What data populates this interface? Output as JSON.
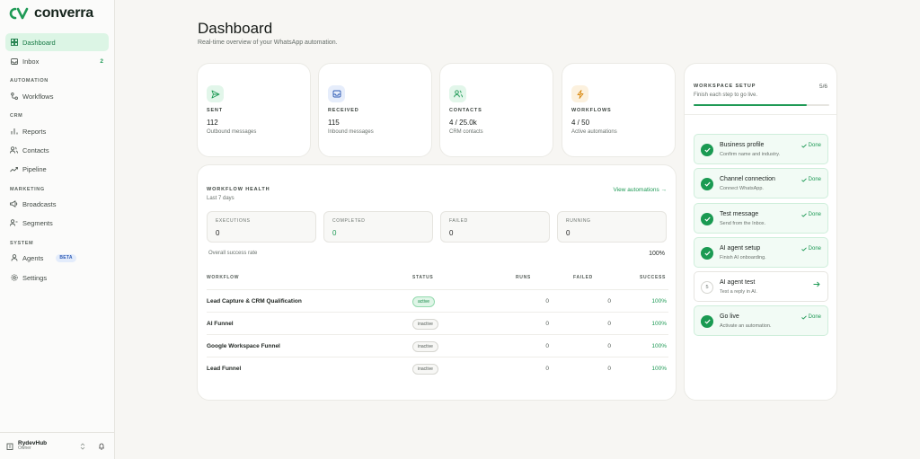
{
  "brand": {
    "name": "converra",
    "logo_text": "CV"
  },
  "sidebar": {
    "top_items": [
      {
        "label": "Dashboard",
        "icon": "grid-icon",
        "active": true
      },
      {
        "label": "Inbox",
        "icon": "inbox-icon",
        "badge": "2"
      }
    ],
    "sections": [
      {
        "label": "AUTOMATION",
        "items": [
          {
            "label": "Workflows",
            "icon": "workflow-icon"
          }
        ]
      },
      {
        "label": "CRM",
        "items": [
          {
            "label": "Reports",
            "icon": "bar-chart-icon"
          },
          {
            "label": "Contacts",
            "icon": "users-icon"
          },
          {
            "label": "Pipeline",
            "icon": "trend-icon"
          }
        ]
      },
      {
        "label": "MARKETING",
        "items": [
          {
            "label": "Broadcasts",
            "icon": "broadcast-icon"
          },
          {
            "label": "Segments",
            "icon": "segments-icon"
          }
        ]
      },
      {
        "label": "SYSTEM",
        "items": [
          {
            "label": "Agents",
            "icon": "agent-icon",
            "tag": "BETA"
          },
          {
            "label": "Settings",
            "icon": "gear-icon"
          }
        ]
      }
    ],
    "user": {
      "name": "RydevHub",
      "role": "Owner"
    }
  },
  "header": {
    "title": "Dashboard",
    "subtitle": "Real-time overview of your WhatsApp automation."
  },
  "stats": [
    {
      "label": "SENT",
      "value": "112",
      "desc": "Outbound messages",
      "icon": "send-icon",
      "color": "#1f9a56",
      "bg": "#e2f6ea"
    },
    {
      "label": "RECEIVED",
      "value": "115",
      "desc": "Inbound messages",
      "icon": "inbox-icon",
      "color": "#2f5bb4",
      "bg": "#e6edfb"
    },
    {
      "label": "CONTACTS",
      "value": "4 / 25.0k",
      "desc": "CRM contacts",
      "icon": "users-icon",
      "color": "#1f9a56",
      "bg": "#e2f6ea"
    },
    {
      "label": "WORKFLOWS",
      "value": "4 / 50",
      "desc": "Active automations",
      "icon": "bolt-icon",
      "color": "#d98a12",
      "bg": "#fcf1de"
    }
  ],
  "workflow_health": {
    "title": "WORKFLOW HEALTH",
    "subtitle": "Last 7 days",
    "link": "View automations →",
    "metrics": [
      {
        "label": "EXECUTIONS",
        "value": "0"
      },
      {
        "label": "COMPLETED",
        "value": "0"
      },
      {
        "label": "FAILED",
        "value": "0"
      },
      {
        "label": "RUNNING",
        "value": "0"
      }
    ],
    "rate_label": "Overall success rate",
    "rate_value": "100%",
    "columns": [
      "WORKFLOW",
      "STATUS",
      "RUNS",
      "FAILED",
      "SUCCESS"
    ],
    "rows": [
      {
        "name": "Lead Capture & CRM Qualification",
        "status": "active",
        "runs": "0",
        "failed": "0",
        "success": "100%"
      },
      {
        "name": "AI Funnel",
        "status": "inactive",
        "runs": "0",
        "failed": "0",
        "success": "100%"
      },
      {
        "name": "Google Workspace Funnel",
        "status": "inactive",
        "runs": "0",
        "failed": "0",
        "success": "100%"
      },
      {
        "name": "Lead Funnel",
        "status": "inactive",
        "runs": "0",
        "failed": "0",
        "success": "100%"
      }
    ]
  },
  "setup": {
    "title": "WORKSPACE SETUP",
    "count": "5/6",
    "subtitle": "Finish each step to go live.",
    "progress": 0.833,
    "steps": [
      {
        "title": "Business profile",
        "sub": "Confirm name and industry.",
        "done": true,
        "done_label": "Done"
      },
      {
        "title": "Channel connection",
        "sub": "Connect WhatsApp.",
        "done": true,
        "done_label": "Done"
      },
      {
        "title": "Test message",
        "sub": "Send from the Inbox.",
        "done": true,
        "done_label": "Done"
      },
      {
        "title": "AI agent setup",
        "sub": "Finish AI onboarding.",
        "done": true,
        "done_label": "Done"
      },
      {
        "title": "AI agent test",
        "sub": "Test a reply in AI.",
        "done": false,
        "num": "5"
      },
      {
        "title": "Go live",
        "sub": "Activate an automation.",
        "done": true,
        "done_label": "Done"
      }
    ]
  }
}
